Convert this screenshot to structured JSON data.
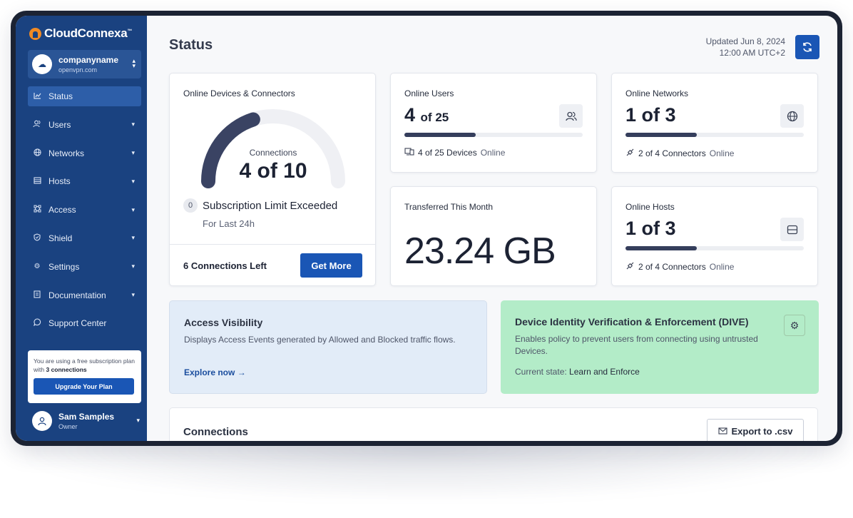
{
  "app": {
    "logo_text": "CloudConnexa",
    "logo_mark": "™"
  },
  "org": {
    "name": "companyname",
    "domain": "openvpn.com"
  },
  "sidebar": {
    "items": [
      {
        "label": "Status",
        "icon": "chart-icon"
      },
      {
        "label": "Users",
        "icon": "users-icon"
      },
      {
        "label": "Networks",
        "icon": "globe-icon"
      },
      {
        "label": "Hosts",
        "icon": "server-icon"
      },
      {
        "label": "Access",
        "icon": "access-icon"
      },
      {
        "label": "Shield",
        "icon": "shield-icon"
      },
      {
        "label": "Settings",
        "icon": "gear-icon"
      },
      {
        "label": "Documentation",
        "icon": "doc-icon"
      },
      {
        "label": "Support Center",
        "icon": "chat-icon"
      }
    ],
    "promo": {
      "text_prefix": "You are using a free subscription plan with ",
      "text_bold": "3 connections",
      "button": "Upgrade Your Plan"
    },
    "user": {
      "name": "Sam Samples",
      "role": "Owner"
    }
  },
  "header": {
    "title": "Status",
    "updated_line1": "Updated Jun 8, 2024",
    "updated_line2": "12:00 AM UTC+2"
  },
  "devices_card": {
    "title": "Online Devices & Connectors",
    "gauge_label": "Connections",
    "gauge_value": "4 of 10",
    "gauge_fraction": 0.4,
    "limit_count": "0",
    "limit_text": "Subscription Limit Exceeded",
    "limit_sub": "For Last 24h",
    "connections_left": "6 Connections Left",
    "get_more": "Get More"
  },
  "online_users": {
    "title": "Online Users",
    "value": "4",
    "value_suffix": "of 25",
    "progress": 0.4,
    "sub_bold": "4 of 25 Devices",
    "sub_muted": "Online"
  },
  "online_networks": {
    "title": "Online Networks",
    "value": "1 of 3",
    "progress": 0.4,
    "sub_bold": "2 of 4 Connectors",
    "sub_muted": "Online"
  },
  "transferred": {
    "title": "Transferred This Month",
    "value": "23.24 GB"
  },
  "online_hosts": {
    "title": "Online Hosts",
    "value": "1 of 3",
    "progress": 0.4,
    "sub_bold": "2 of 4 Connectors",
    "sub_muted": "Online"
  },
  "access_visibility": {
    "title": "Access Visibility",
    "desc": "Displays Access Events generated by Allowed and Blocked traffic flows.",
    "link": "Explore now",
    "bg": "#e2ecf8"
  },
  "dive": {
    "title": "Device Identity Verification & Enforcement (DIVE)",
    "desc": "Enables policy to prevent users from connecting using untrusted Devices.",
    "state_label": "Current state:",
    "state_value": "Learn and Enforce",
    "bg": "#b3ecc8"
  },
  "connections": {
    "title": "Connections",
    "export": "Export to .csv"
  },
  "colors": {
    "sidebar": "#1a4280",
    "accent": "#1a56b5",
    "progress": "#353e5c"
  }
}
